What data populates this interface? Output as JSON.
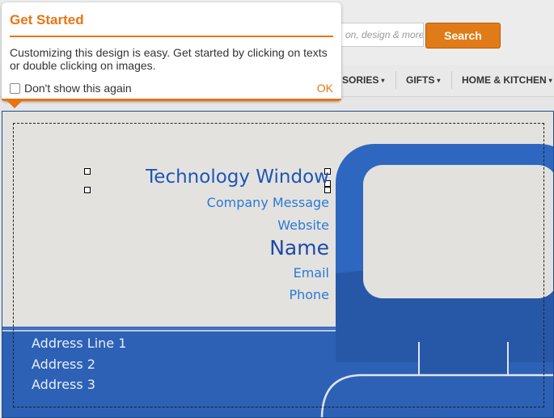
{
  "header": {
    "search_placeholder": "on, design & more.",
    "search_button": "Search"
  },
  "nav": {
    "items": [
      "SORIES",
      "GIFTS",
      "HOME & KITCHEN"
    ],
    "caret": "▾"
  },
  "popup": {
    "title": "Get Started",
    "body": "Customizing this design is easy. Get started by clicking on texts or double clicking on images.",
    "checkbox_label": "Don't show this again",
    "ok_label": "OK"
  },
  "card": {
    "company": "Technology Window",
    "company_message": "Company Message",
    "website": "Website",
    "name": "Name",
    "email": "Email",
    "phone": "Phone",
    "address_lines": [
      "Address Line 1",
      "Address 2",
      "Address 3"
    ]
  },
  "colors": {
    "accent_orange": "#e87511",
    "card_blue": "#2d61b5",
    "card_light": "#e4e2df",
    "text_blue": "#1e56b7"
  }
}
